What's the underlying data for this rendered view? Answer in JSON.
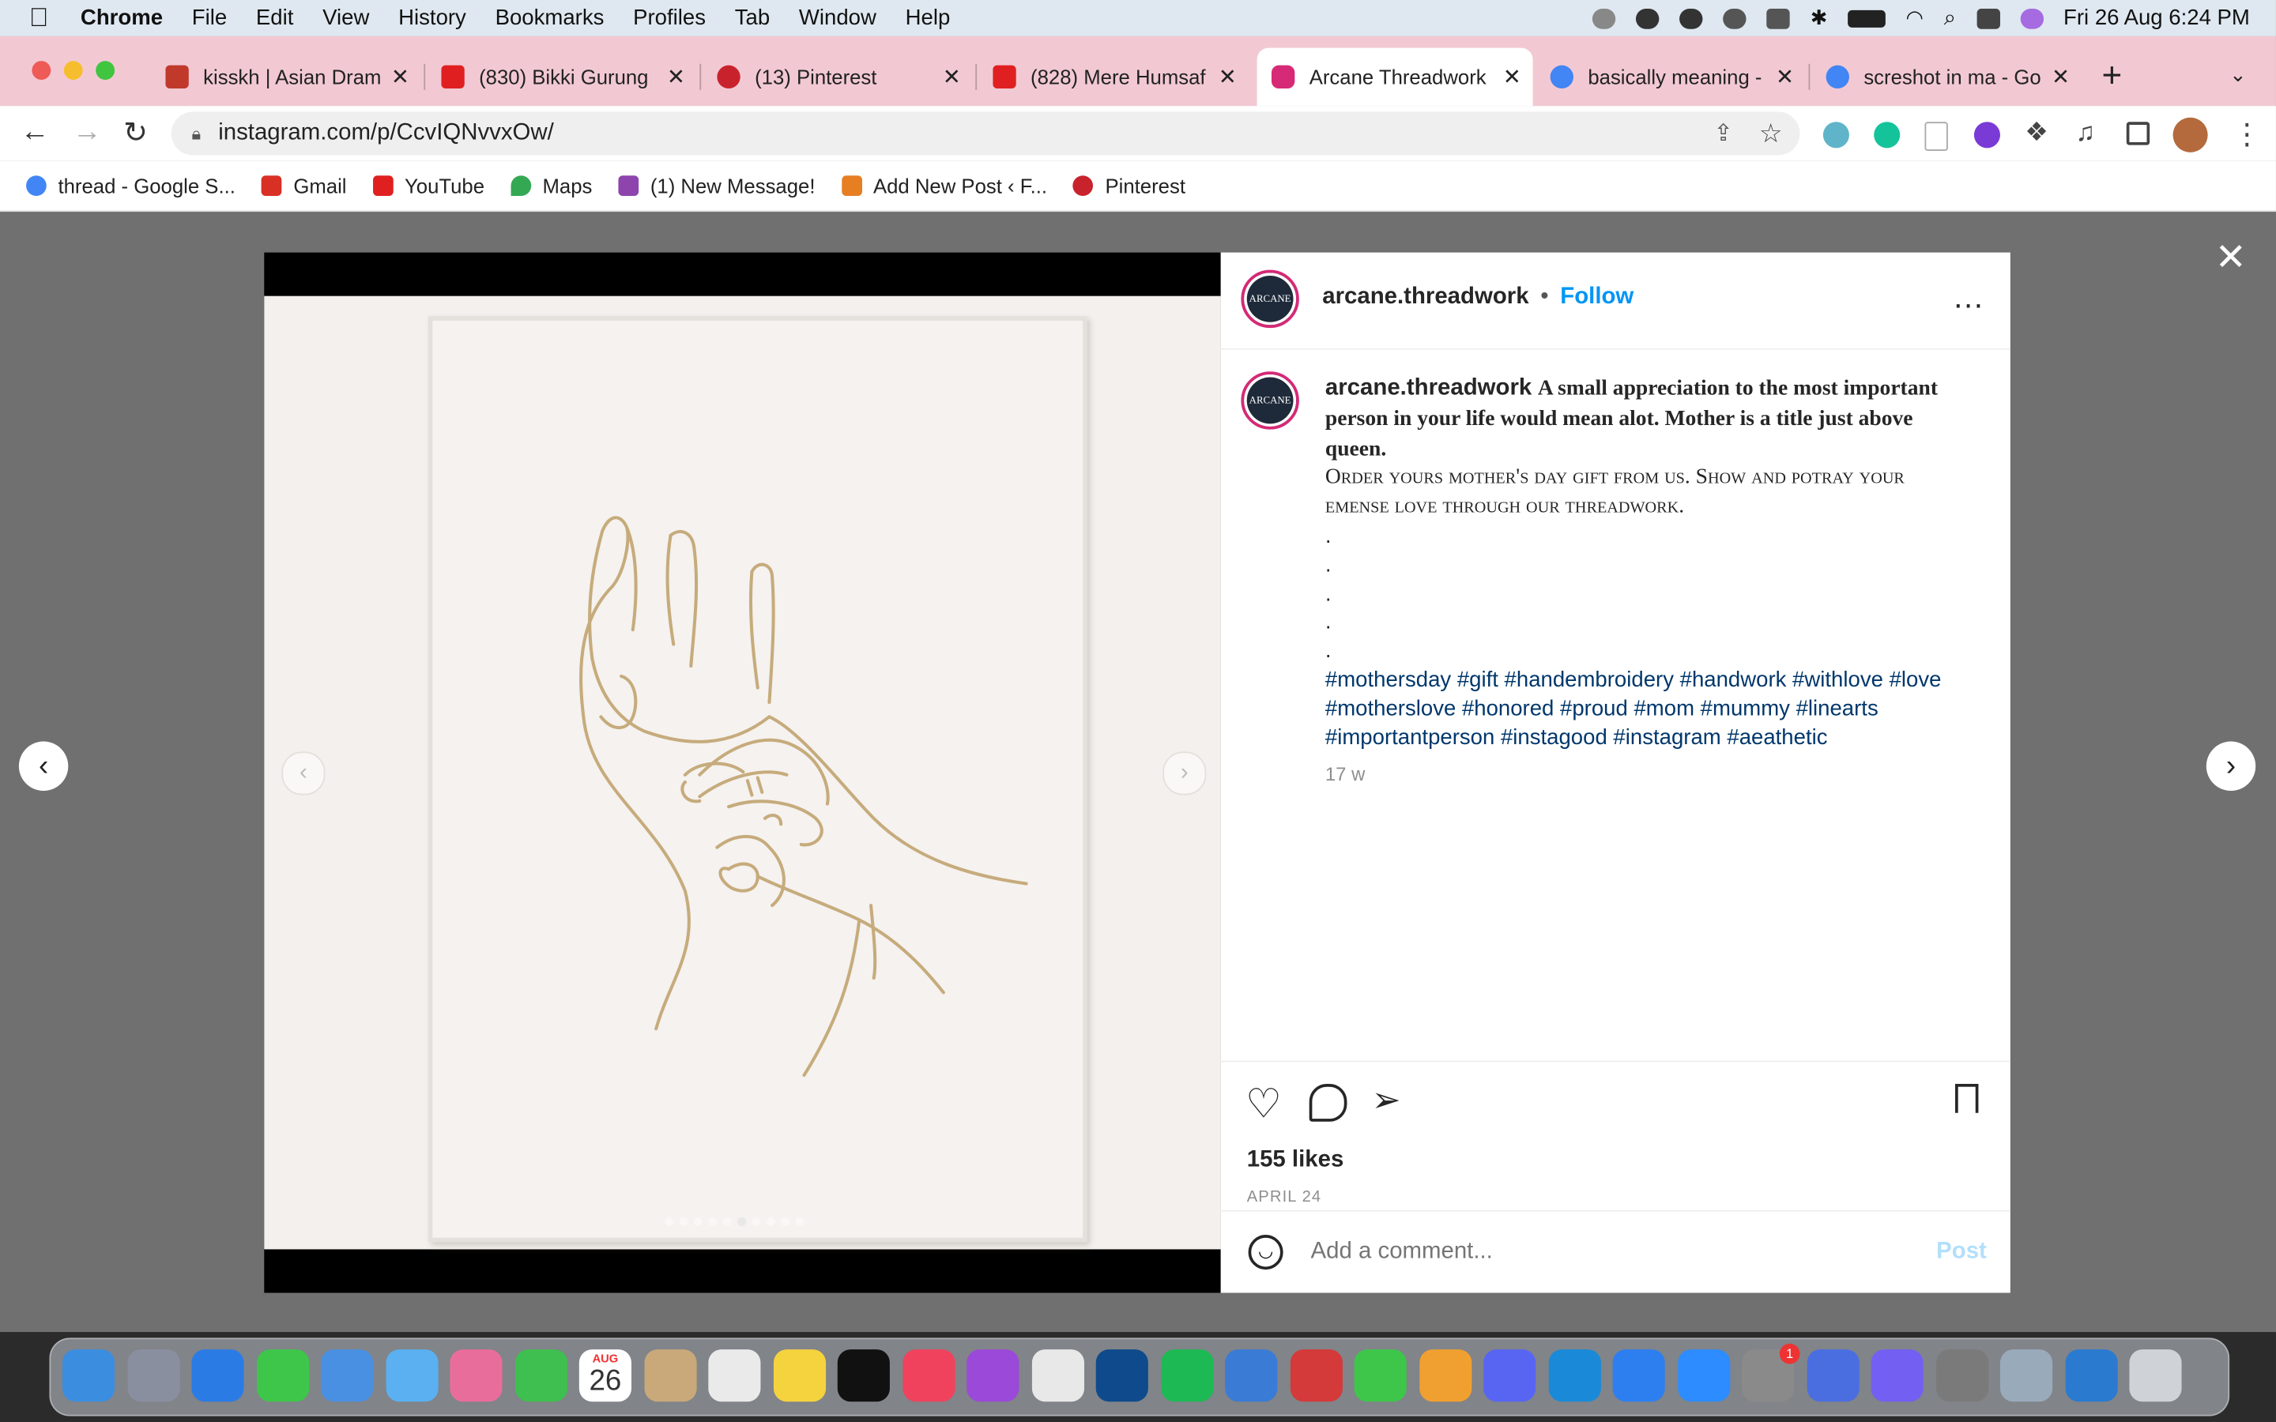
{
  "menubar": {
    "app": "Chrome",
    "items": [
      "File",
      "Edit",
      "View",
      "History",
      "Bookmarks",
      "Profiles",
      "Tab",
      "Window",
      "Help"
    ],
    "datetime": "Fri 26 Aug  6:24 PM"
  },
  "tabs": [
    {
      "label": "kisskh | Asian Dram",
      "color": "#c0392b"
    },
    {
      "label": "(830) Bikki Gurung",
      "color": "#e02020"
    },
    {
      "label": "(13) Pinterest",
      "color": "#c8232c"
    },
    {
      "label": "(828) Mere Humsaf",
      "color": "#e02020"
    },
    {
      "label": "Arcane Threadwork",
      "color": "#d62976"
    },
    {
      "label": "basically meaning -",
      "color": "#4285f4"
    },
    {
      "label": "screshot in ma - Go",
      "color": "#4285f4"
    }
  ],
  "url": "instagram.com/p/CcvIQNvvxOw/",
  "bookmarks": [
    {
      "label": "thread - Google S...",
      "color": "#4285f4"
    },
    {
      "label": "Gmail",
      "color": "#d93025"
    },
    {
      "label": "YouTube",
      "color": "#e02020"
    },
    {
      "label": "Maps",
      "color": "#34a853"
    },
    {
      "label": "(1) New Message!",
      "color": "#8e44ad"
    },
    {
      "label": "Add New Post ‹ F...",
      "color": "#e67e22"
    },
    {
      "label": "Pinterest",
      "color": "#c8232c"
    }
  ],
  "post": {
    "username": "arcane.threadwork",
    "follow": "Follow",
    "avatar_text": "ARCANE",
    "caption_bold": "A small appreciation to the most important person in your life would mean alot. Mother is a title just above queen.",
    "caption_smallcaps": "Order yours mother's day gift from us. Show and potray your emense love through our threadwork.",
    "dots": [
      ".",
      ".",
      ".",
      ".",
      "."
    ],
    "hashtags": "#mothersday #gift #handembroidery #handwork #withlove #love #motherslove #honored #proud #mom #mummy #linearts #importantperson #instagood #instagram #aeathetic",
    "age": "17 w",
    "likes": "155 likes",
    "date": "APRIL 24",
    "comment_placeholder": "Add a comment...",
    "post_label": "Post",
    "carousel_count": 10,
    "carousel_active": 6
  },
  "dock": {
    "calendar_month": "AUG",
    "calendar_day": "26",
    "badge": "1",
    "apps": [
      "#3b8de0",
      "#8a8fa0",
      "#2b7be5",
      "#3ec64a",
      "#4a90e2",
      "#5ab0f0",
      "#e96d9a",
      "#3fbf4f",
      "#ffffff",
      "#c9a87a",
      "#eaeaea",
      "#f5d33f",
      "#111111",
      "#f0425d",
      "#9b49d8",
      "#e8e8e8",
      "#0f4a8c",
      "#1db954",
      "#3a7bd5",
      "#d43a3a",
      "#3ec64a",
      "#f0a030",
      "#5865f2",
      "#1a8ad8",
      "#2d7ff0",
      "#2d8cff",
      "#8a8a8a",
      "#4a6ee0",
      "#7360f2",
      "#7a7a7a",
      "#9ab",
      "#2a7ad0",
      "#cfd3d8"
    ]
  }
}
